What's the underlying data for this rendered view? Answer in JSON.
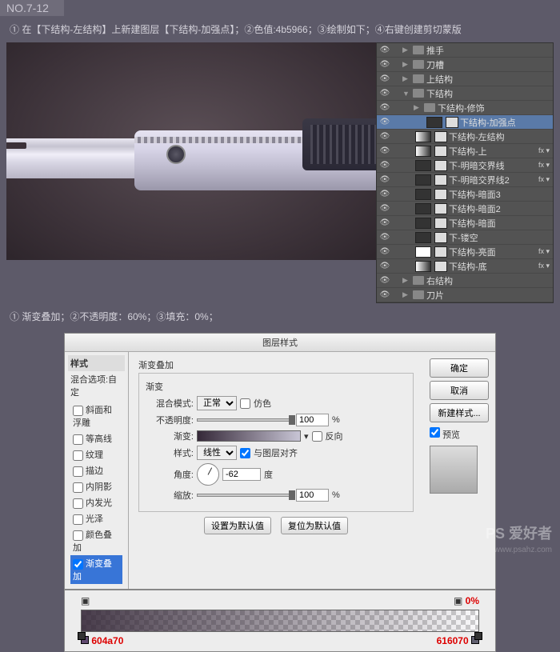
{
  "header": {
    "step_no": "NO.7-12"
  },
  "instructions": {
    "line1": "① 在【下结构-左结构】上新建图层【下结构-加强点】；②色值:4b5966；③绘制如下；④右键创建剪切蒙版",
    "line2": "① 渐变叠加；②不透明度：60%；③填充：0%；"
  },
  "layers": [
    {
      "name": "推手",
      "type": "folder",
      "visible": true,
      "indent": 0,
      "arrow": "▶"
    },
    {
      "name": "刀槽",
      "type": "folder",
      "visible": true,
      "indent": 0,
      "arrow": "▶"
    },
    {
      "name": "上结构",
      "type": "folder",
      "visible": true,
      "indent": 0,
      "arrow": "▶"
    },
    {
      "name": "下结构",
      "type": "folder",
      "visible": true,
      "indent": 0,
      "arrow": "▼"
    },
    {
      "name": "下结构-修饰",
      "type": "folder",
      "visible": true,
      "indent": 1,
      "arrow": "▶"
    },
    {
      "name": "下结构-加强点",
      "type": "layer",
      "visible": true,
      "indent": 2,
      "selected": true,
      "thumb": "dark",
      "mask": true
    },
    {
      "name": "下结构-左结构",
      "type": "layer",
      "visible": true,
      "indent": 1,
      "thumb": "grad",
      "mask": true
    },
    {
      "name": "下结构-上",
      "type": "layer",
      "visible": true,
      "indent": 1,
      "thumb": "grad",
      "mask": true,
      "fx": true
    },
    {
      "name": "下-明暗交界线",
      "type": "layer",
      "visible": true,
      "indent": 1,
      "thumb": "dark",
      "mask": true,
      "fx": true
    },
    {
      "name": "下-明暗交界线2",
      "type": "layer",
      "visible": true,
      "indent": 1,
      "thumb": "dark",
      "mask": true,
      "fx": true
    },
    {
      "name": "下结构-暗面3",
      "type": "layer",
      "visible": true,
      "indent": 1,
      "thumb": "dark",
      "mask": true
    },
    {
      "name": "下结构-暗面2",
      "type": "layer",
      "visible": true,
      "indent": 1,
      "thumb": "dark",
      "mask": true
    },
    {
      "name": "下结构-暗面",
      "type": "layer",
      "visible": true,
      "indent": 1,
      "thumb": "dark",
      "mask": true
    },
    {
      "name": "下-镂空",
      "type": "layer",
      "visible": true,
      "indent": 1,
      "thumb": "dark",
      "mask": true
    },
    {
      "name": "下结构-亮面",
      "type": "layer",
      "visible": true,
      "indent": 1,
      "thumb": "light",
      "mask": true,
      "fx": true
    },
    {
      "name": "下结构-底",
      "type": "layer",
      "visible": true,
      "indent": 1,
      "thumb": "grad",
      "mask": true,
      "fx": true
    },
    {
      "name": "右结构",
      "type": "folder",
      "visible": true,
      "indent": 0,
      "arrow": "▶"
    },
    {
      "name": "刀片",
      "type": "folder",
      "visible": true,
      "indent": 0,
      "arrow": "▶"
    }
  ],
  "dialog": {
    "title": "图层样式",
    "styles_header": "样式",
    "blend_options": "混合选项:自定",
    "style_items": [
      "斜面和浮雕",
      "等高线",
      "纹理",
      "描边",
      "内阴影",
      "内发光",
      "光泽",
      "颜色叠加",
      "渐变叠加"
    ],
    "selected_style": "渐变叠加",
    "group_title": "渐变叠加",
    "group_sub": "渐变",
    "labels": {
      "blend_mode": "混合模式:",
      "opacity": "不透明度:",
      "gradient": "渐变:",
      "style": "样式:",
      "angle": "角度:",
      "scale": "缩放:",
      "dither": "仿色",
      "align": "与图层对齐",
      "reverse": "反向",
      "degree": "度",
      "percent": "%"
    },
    "values": {
      "blend_mode": "正常",
      "opacity": "100",
      "style": "线性",
      "angle": "-62",
      "scale": "100",
      "dither": false,
      "align": true,
      "reverse": false
    },
    "buttons": {
      "ok": "确定",
      "cancel": "取消",
      "new_style": "新建样式...",
      "preview": "预览",
      "set_default": "设置为默认值",
      "reset_default": "复位为默认值"
    }
  },
  "gradient_editor": {
    "left_pct": "0%",
    "left_color": "604a70",
    "right_color": "616070"
  },
  "watermark": {
    "brand": "PS 爱好者",
    "url": "www.psahz.com"
  }
}
